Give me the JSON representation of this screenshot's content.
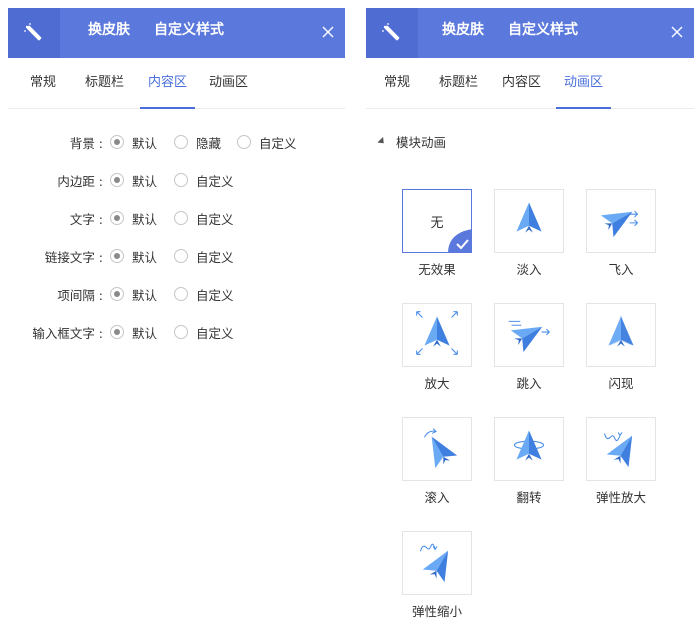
{
  "left": {
    "tabs": [
      "换皮肤",
      "自定义样式"
    ],
    "subtabs": [
      "常规",
      "标题栏",
      "内容区",
      "动画区"
    ],
    "active_subtab": "内容区",
    "rows": [
      {
        "label": "背景 :",
        "options": [
          "默认",
          "隐藏",
          "自定义"
        ],
        "selected": "默认"
      },
      {
        "label": "内边距 :",
        "options": [
          "默认",
          "自定义"
        ],
        "selected": "默认"
      },
      {
        "label": "文字 :",
        "options": [
          "默认",
          "自定义"
        ],
        "selected": "默认"
      },
      {
        "label": "链接文字 :",
        "options": [
          "默认",
          "自定义"
        ],
        "selected": "默认"
      },
      {
        "label": "项间隔 :",
        "options": [
          "默认",
          "自定义"
        ],
        "selected": "默认"
      },
      {
        "label": "输入框文字 :",
        "options": [
          "默认",
          "自定义"
        ],
        "selected": "默认"
      }
    ]
  },
  "right": {
    "tabs": [
      "换皮肤",
      "自定义样式"
    ],
    "subtabs": [
      "常规",
      "标题栏",
      "内容区",
      "动画区"
    ],
    "active_subtab": "动画区",
    "section_title": "模块动画",
    "animations": [
      {
        "name": "无效果",
        "box_text": "无",
        "selected": true,
        "icon": "none"
      },
      {
        "name": "淡入",
        "icon": "plane-fade-icon"
      },
      {
        "name": "飞入",
        "icon": "plane-fly-in-icon"
      },
      {
        "name": "放大",
        "icon": "plane-zoom-icon"
      },
      {
        "name": "跳入",
        "icon": "plane-jump-icon"
      },
      {
        "name": "闪现",
        "icon": "plane-flash-icon"
      },
      {
        "name": "滚入",
        "icon": "plane-roll-icon"
      },
      {
        "name": "翻转",
        "icon": "plane-flip-icon"
      },
      {
        "name": "弹性放大",
        "icon": "plane-elastic-zoom-icon"
      },
      {
        "name": "弹性缩小",
        "icon": "plane-elastic-shrink-icon"
      }
    ]
  },
  "colors": {
    "header": "#5b78dc",
    "accent": "#4a6fdc",
    "icon_blue": "#4d8fe8"
  }
}
